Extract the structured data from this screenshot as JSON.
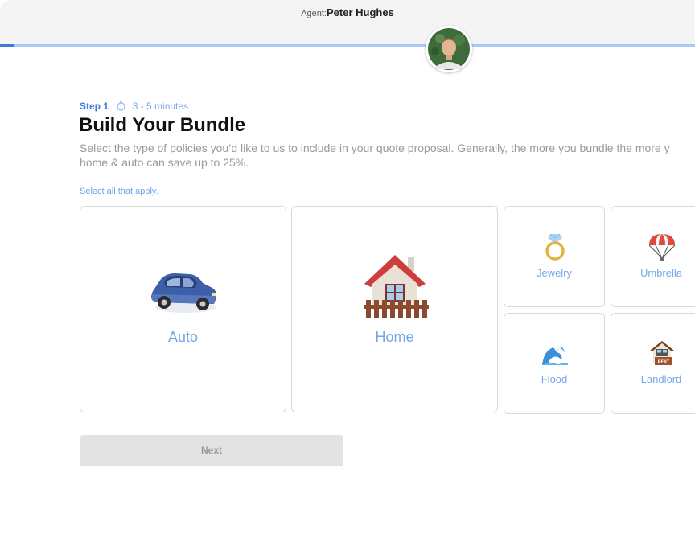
{
  "header": {
    "agent_label": "Agent:",
    "agent_name": "Peter Hughes",
    "progress_fraction": 0.02
  },
  "step": {
    "label": "Step 1",
    "duration": "3 - 5 minutes",
    "icon": "stopwatch-icon"
  },
  "main": {
    "title": "Build Your Bundle",
    "subtitle_line1": "Select the type of policies you’d like to us to include in your quote proposal. Generally, the more you bundle the more y",
    "subtitle_line2": "home & auto can save up to 25%.",
    "instruction": "Select all that apply."
  },
  "options": {
    "auto": {
      "label": "Auto",
      "icon": "car-icon"
    },
    "home": {
      "label": "Home",
      "icon": "house-icon"
    },
    "jewelry": {
      "label": "Jewelry",
      "icon": "ring-icon"
    },
    "umbrella": {
      "label": "Umbrella",
      "icon": "parachute-icon"
    },
    "flood": {
      "label": "Flood",
      "icon": "wave-icon"
    },
    "landlord": {
      "label": "Landlord",
      "icon": "rent-house-icon"
    }
  },
  "actions": {
    "next_label": "Next"
  },
  "colors": {
    "accent": "#3b7ad9",
    "label_blue": "#76a7ea",
    "progress_track": "#a9c8f5",
    "button_disabled_bg": "#e3e3e3"
  }
}
